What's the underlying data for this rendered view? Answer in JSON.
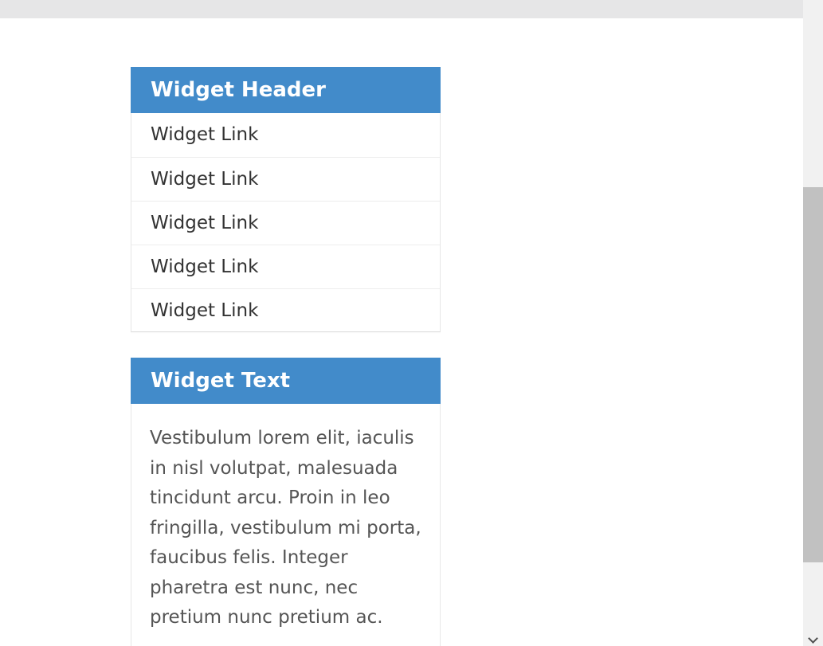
{
  "widgets": {
    "links": {
      "title": "Widget Header",
      "items": [
        "Widget Link",
        "Widget Link",
        "Widget Link",
        "Widget Link",
        "Widget Link"
      ]
    },
    "text": {
      "title": "Widget Text",
      "body": "Vestibulum lorem elit, iaculis in nisl volutpat, malesuada tincidunt arcu. Proin in leo fringilla, vestibulum mi porta, faucibus felis. Integer pharetra est nunc, nec pretium nunc pretium ac."
    }
  },
  "icons": {
    "scroll_down": "chevron-down-icon"
  },
  "colors": {
    "header_background": "#428bca",
    "header_text": "#ffffff",
    "link_text": "#333333",
    "body_text": "#555555",
    "top_bar": "#e6e6e7",
    "scrollbar_track": "#f1f1f1",
    "scrollbar_thumb": "#c1c1c1"
  }
}
